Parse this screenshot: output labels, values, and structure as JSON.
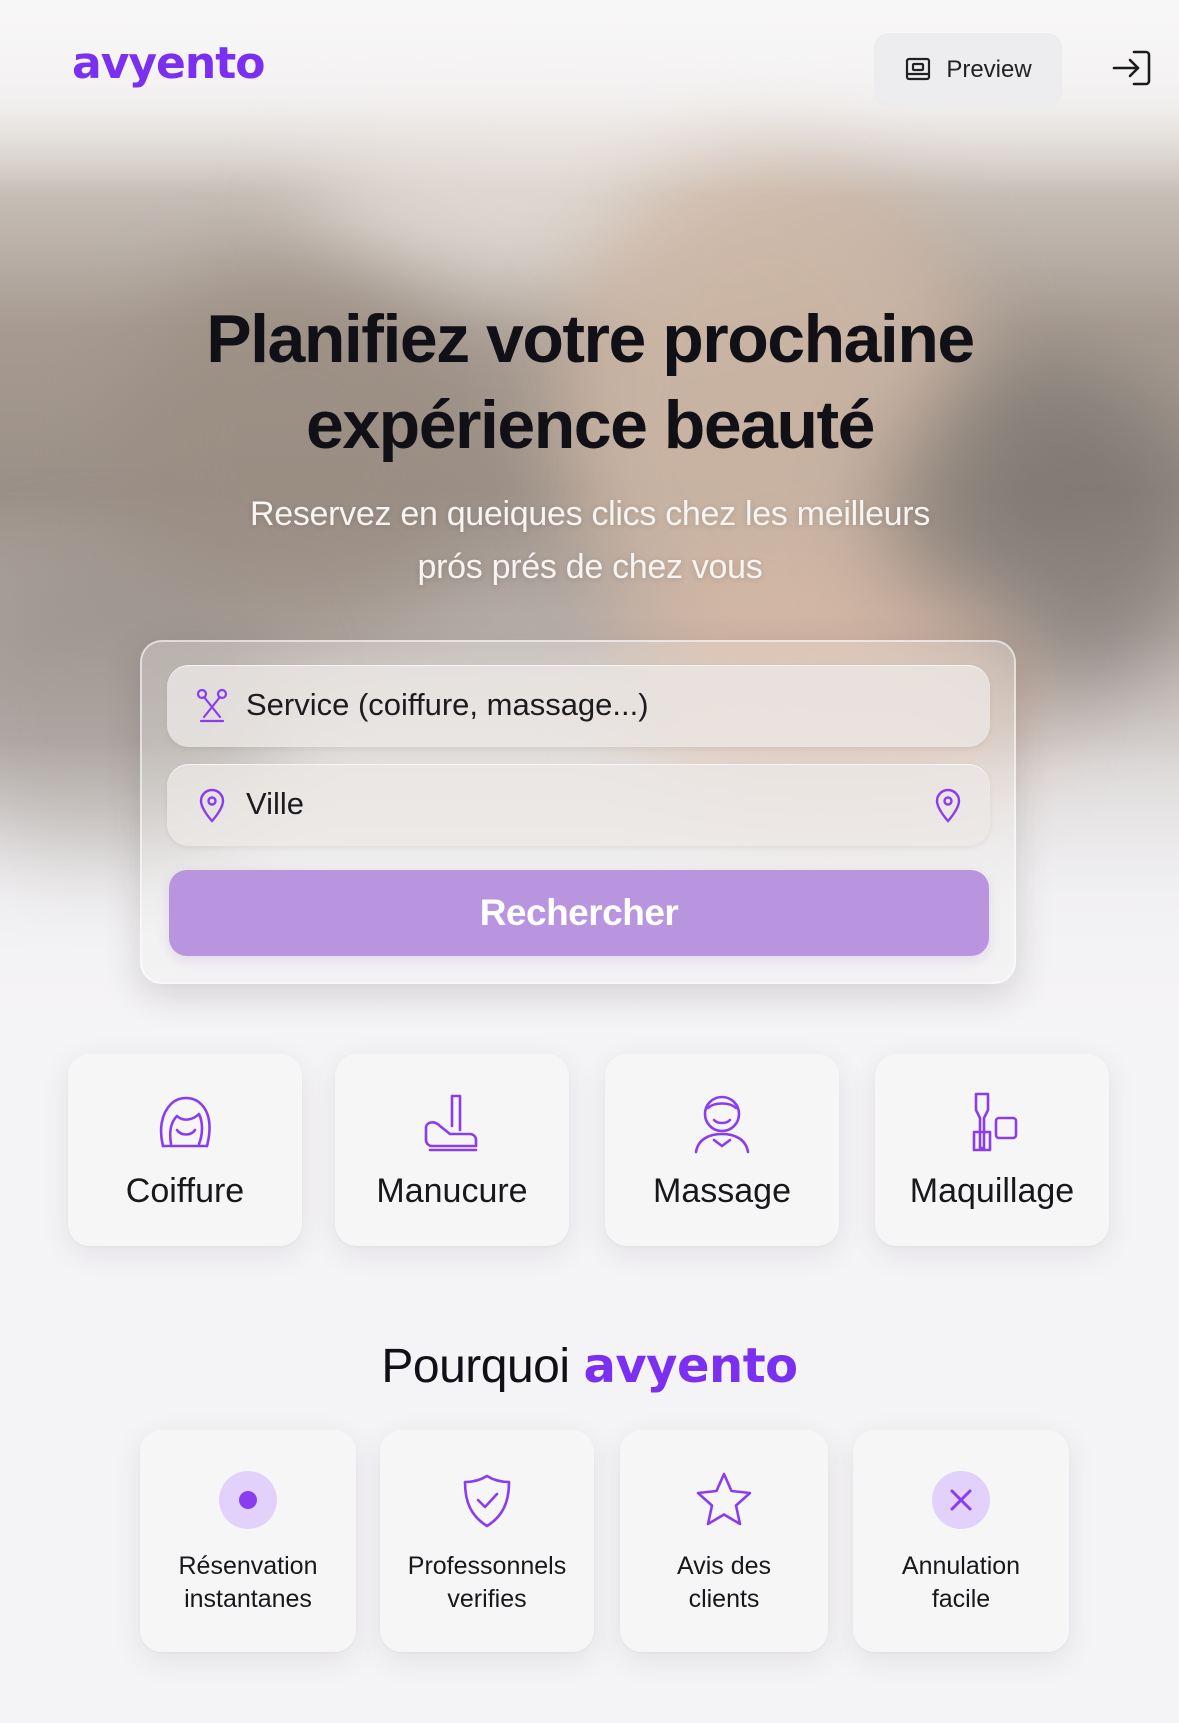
{
  "brand": {
    "name": "avyento",
    "color": "#7b2ff0"
  },
  "header": {
    "preview_label": "Preview",
    "preview_icon": "preview-icon",
    "login_icon": "login-icon"
  },
  "hero": {
    "title_line1": "Planifiez votre prochaine",
    "title_line2": "expérience beauté",
    "subtitle_line1": "Reservez en queiques clics chez les meilleurs",
    "subtitle_line2": "prós prés de chez vous"
  },
  "search": {
    "service_placeholder": "Service (coiffure, massage...)",
    "ville_placeholder": "Ville",
    "button_label": "Rechercher",
    "button_color": "#b895de"
  },
  "categories": [
    {
      "label": "Coiffure",
      "icon": "hair-icon"
    },
    {
      "label": "Manucure",
      "icon": "nail-icon"
    },
    {
      "label": "Massage",
      "icon": "massage-icon"
    },
    {
      "label": "Maquillage",
      "icon": "makeup-icon"
    }
  ],
  "why": {
    "title": "Pourquoi",
    "brand": "avyento",
    "features": [
      {
        "line1": "Résenvation",
        "line2": "instantanes",
        "icon": "instant-dot-icon"
      },
      {
        "line1": "Professonnels",
        "line2": "verifies",
        "icon": "shield-check-icon"
      },
      {
        "line1": "Avis des",
        "line2": "clients",
        "icon": "star-icon"
      },
      {
        "line1": "Annulation",
        "line2": "facile",
        "icon": "cancel-x-icon"
      }
    ]
  }
}
